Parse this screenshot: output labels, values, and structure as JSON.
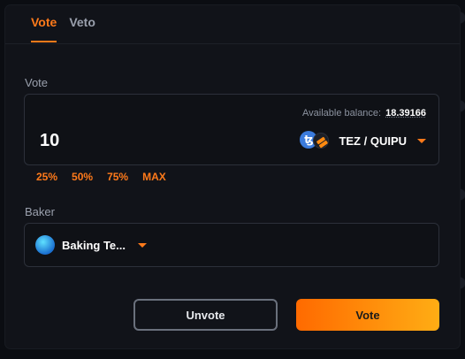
{
  "tabs": [
    {
      "label": "Vote",
      "active": true
    },
    {
      "label": "Veto",
      "active": false
    }
  ],
  "vote": {
    "label": "Vote",
    "balance_label": "Available balance:",
    "balance_value": "18.39166",
    "amount": "10",
    "token_pair": "TEZ / QUIPU",
    "token_icons": [
      "tez-icon",
      "quipu-icon"
    ]
  },
  "percent_buttons": [
    "25%",
    "50%",
    "75%",
    "MAX"
  ],
  "baker": {
    "label": "Baker",
    "selected": "Baking Te...",
    "icon": "baker-logo-icon"
  },
  "actions": {
    "unvote_label": "Unvote",
    "vote_label": "Vote"
  },
  "colors": {
    "accent": "#ff7a1a",
    "vote_gradient_start": "#ff6a00",
    "vote_gradient_end": "#ffad14",
    "card_bg": "#111319"
  }
}
